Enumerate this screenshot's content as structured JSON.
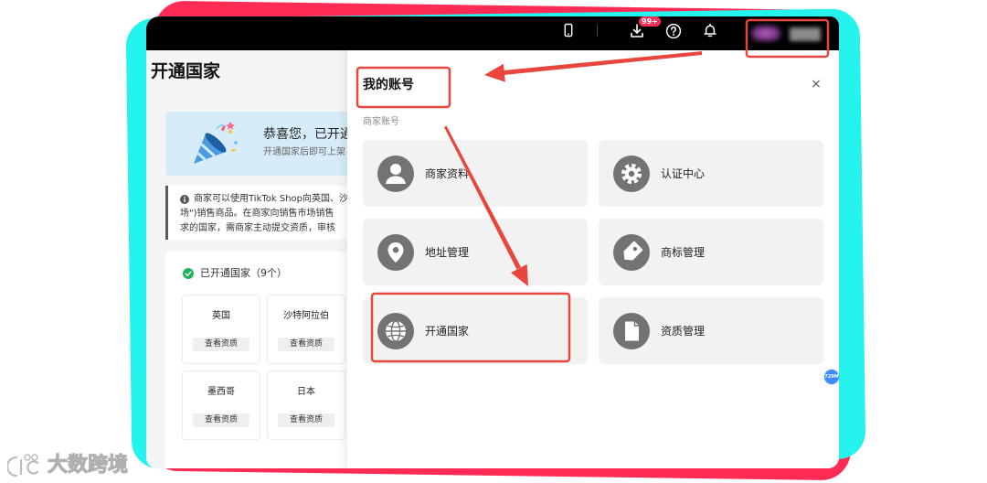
{
  "topbar": {
    "download_badge": "99+",
    "icons": {
      "mobile": "mobile-icon",
      "download": "download-icon",
      "help": "help-icon",
      "notifications": "bell-icon"
    }
  },
  "page": {
    "title": "开通国家",
    "banner": {
      "heading": "恭喜您，已开通",
      "subtext": "开通国家后即可上架",
      "icon": "party-popper-icon"
    },
    "notice": {
      "icon": "info-icon",
      "lines": [
        "商家可以使用TikTok Shop向英国、沙",
        "场\")销售商品。在商家向销售市场销售",
        "求的国家，需商家主动提交资质，审核"
      ]
    },
    "opened_countries": {
      "icon": "check-circle-icon",
      "label": "已开通国家（9个）",
      "countries": [
        {
          "name": "英国",
          "action": "查看资质"
        },
        {
          "name": "沙特阿拉伯",
          "action": "查看资质"
        },
        {
          "name": "墨西哥",
          "action": "查看资质"
        },
        {
          "name": "日本",
          "action": "查看资质"
        }
      ]
    }
  },
  "drawer": {
    "title": "我的账号",
    "close": "×",
    "section_label": "商家账号",
    "items": [
      {
        "label": "商家资料",
        "icon": "user-icon"
      },
      {
        "label": "认证中心",
        "icon": "gear-icon"
      },
      {
        "label": "地址管理",
        "icon": "location-pin-icon"
      },
      {
        "label": "商标管理",
        "icon": "tag-icon"
      },
      {
        "label": "开通国家",
        "icon": "globe-icon"
      },
      {
        "label": "资质管理",
        "icon": "document-icon"
      }
    ]
  },
  "floating_badge": "729M",
  "watermark": "大数跨境",
  "colors": {
    "frame_red": "#fe2c55",
    "frame_cyan": "#25f4ee",
    "topbar": "#000000",
    "annotation_red": "#e8453c",
    "banner_bg": "#d7ecf9",
    "success_green": "#22b35e",
    "icon_gray": "#737373",
    "item_bg": "#f2f2f2",
    "badge_blue": "#3d8bfd"
  }
}
